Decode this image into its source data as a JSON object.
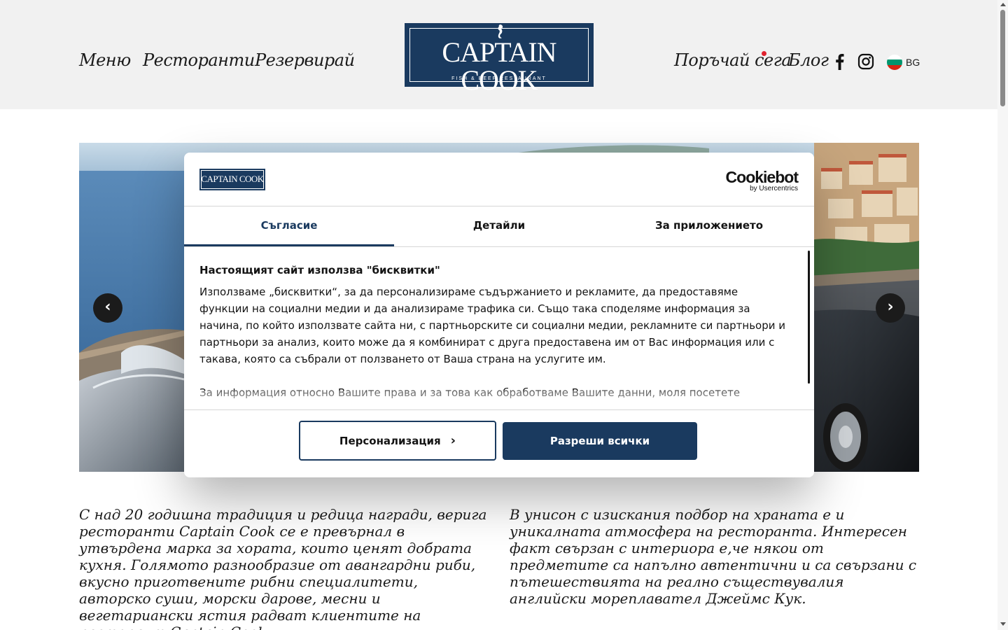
{
  "header": {
    "nav_left": [
      "Меню",
      "Ресторанти",
      "Резервирай"
    ],
    "logo": {
      "name": "CAPTAIN COOK",
      "tagline": "FISH & BEEF RESTAURANT"
    },
    "nav_right": {
      "order": "Поръчай сега",
      "blog": "Блог"
    },
    "social": [
      "facebook-icon",
      "instagram-icon"
    ],
    "language": "BG"
  },
  "hero": {
    "prev_arrow": "‹",
    "next_arrow": "›"
  },
  "content": {
    "left_text": "С над 20 годишна традиция и редица награди, верига ресторанти Captain Cook се е превърнал в утвърдена марка за хората, които ценят добрата кухня. Голямото разнообразие от авангардни риби, вкусно приготвените рибни специалитети, авторско суши, морски дарове, месни и вегетариански ястия радват клиентите на ресторант Captain Cook.",
    "right_text": "В унисон с изискания подбор на храната е и уникалната атмосфера на ресторанта. Интересен факт свързан с интериора е,че някои от предметите са напълно автентични и са свързани с пътешествията на реално съществувалия английски мореплавател Джеймс Кук."
  },
  "cookie_dialog": {
    "logo_text": "CAPTAIN COOK",
    "cookiebot_name": "Cookiebot",
    "cookiebot_by": "by Usercentrics",
    "tabs": [
      "Съгласие",
      "Детайли",
      "За приложението"
    ],
    "heading": "Настоящият сайт използва \"бисквитки\"",
    "paragraph": "Използваме „бисквитки“, за да персонализираме съдържанието и рекламите, да предоставяме функции на социални медии и да анализираме трафика си. Също така споделяме информация за начина, по който използвате сайта ни, с партньорските си социални медии, рекламните си партньори и партньори за анализ, които може да я комбинират с друга предоставена им от Вас информация или с такава, която са събрали от ползването от Ваша страна на услугите им.",
    "paragraph2": "За информация относно Вашите права и за това как обработваме Вашите данни, моля посетете",
    "btn_customize": "Персонализация",
    "btn_allow": "Разреши всички"
  },
  "colors": {
    "brand_navy": "#1a3a5f",
    "header_bg": "#f1f1f1",
    "order_dot": "#e0232f"
  }
}
